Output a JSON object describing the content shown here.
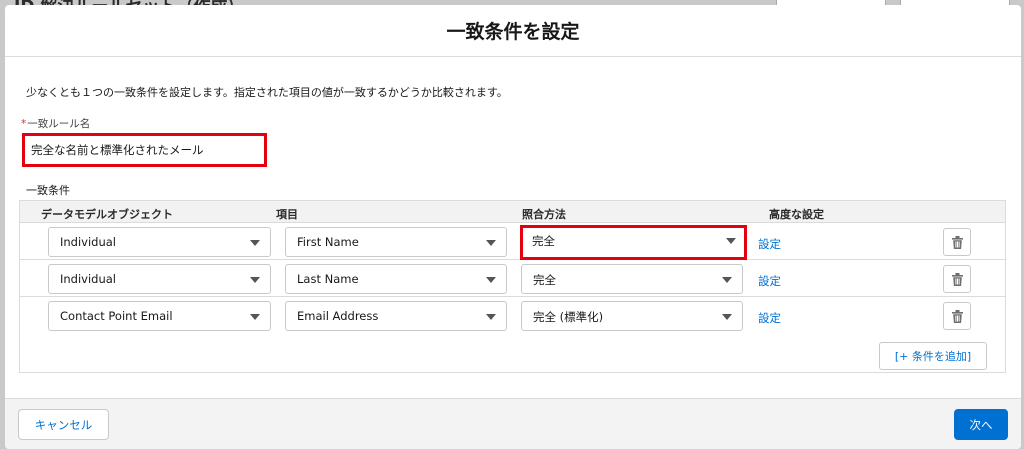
{
  "background": {
    "title": "ID 解決ルールセット（作成）"
  },
  "modal": {
    "title": "一致条件を設定",
    "description": "少なくとも１つの一致条件を設定します。指定された項目の値が一致するかどうか比較されます。",
    "rule_name": {
      "required_marker": "*",
      "label": "一致ルール名",
      "value": "完全な名前と標準化されたメール"
    },
    "conditions": {
      "label": "一致条件",
      "headers": {
        "object": "データモデルオブジェクト",
        "field": "項目",
        "method": "照合方法",
        "advanced": "高度な設定"
      },
      "rows": [
        {
          "object": "Individual",
          "field": "First Name",
          "method": "完全",
          "advanced": "設定"
        },
        {
          "object": "Individual",
          "field": "Last Name",
          "method": "完全",
          "advanced": "設定"
        },
        {
          "object": "Contact Point Email",
          "field": "Email Address",
          "method": "完全 (標準化)",
          "advanced": "設定"
        }
      ],
      "add_button": "[+ 条件を追加]"
    },
    "footer": {
      "cancel": "キャンセル",
      "next": "次へ"
    }
  },
  "colors": {
    "highlight": "#e3000f",
    "brand": "#0070d2"
  },
  "icons": {
    "delete": "trash-icon",
    "dropdown": "chevron-down-icon"
  }
}
